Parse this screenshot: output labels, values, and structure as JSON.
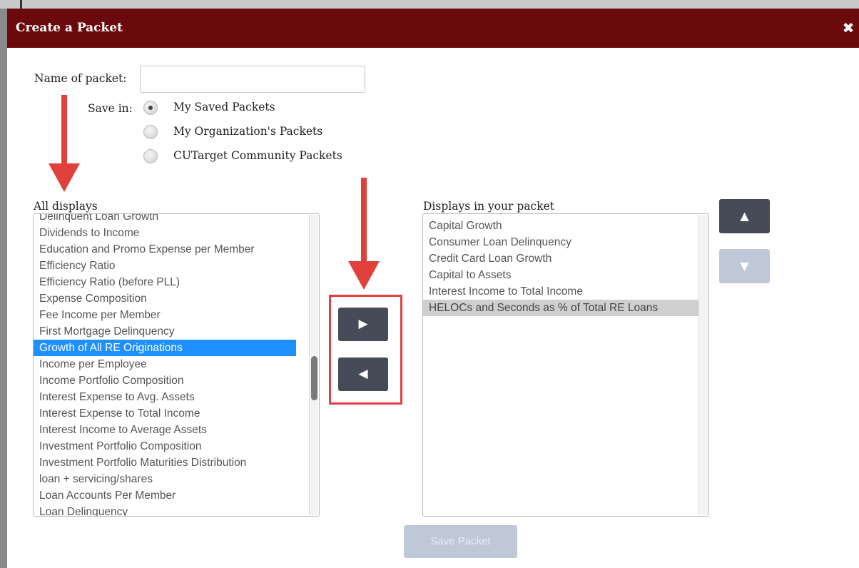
{
  "dialog": {
    "title": "Create a Packet",
    "close_icon": "close-icon",
    "colors": {
      "titlebar": "#6b0a0d",
      "selected": "#1e90ff",
      "dark_button": "#454b57",
      "annotation_red": "#e0413c"
    }
  },
  "form": {
    "name_label": "Name of packet:",
    "name_value": "",
    "save_in_label": "Save in:",
    "options": [
      {
        "label": "My Saved Packets",
        "selected": true
      },
      {
        "label": "My Organization's Packets",
        "selected": false
      },
      {
        "label": "CUTarget Community Packets",
        "selected": false
      }
    ]
  },
  "all_displays": {
    "label": "All displays",
    "items": [
      "Delinquent Loan Growth",
      "Dividends to Income",
      "Education and Promo Expense per Member",
      "Efficiency Ratio",
      "Efficiency Ratio (before PLL)",
      "Expense Composition",
      "Fee Income per Member",
      "First Mortgage Delinquency",
      "Growth of All RE Originations",
      "Income per Employee",
      "Income Portfolio Composition",
      "Interest Expense to Avg. Assets",
      "Interest Expense to Total Income",
      "Interest Income to Average Assets",
      "Investment Portfolio Composition",
      "Investment Portfolio Maturities Distribution",
      "loan + servicing/shares",
      "Loan Accounts Per Member",
      "Loan Delinquency"
    ],
    "selected_item": "Growth of All RE Originations"
  },
  "packet_displays": {
    "label": "Displays in your packet",
    "items": [
      "Capital Growth",
      "Consumer Loan Delinquency",
      "Credit Card Loan Growth",
      "Capital to Assets",
      "Interest Income to Total Income",
      "HELOCs and Seconds as % of Total RE Loans"
    ],
    "highlighted_item": "HELOCs and Seconds as % of Total RE Loans"
  },
  "buttons": {
    "add_glyph": "▶",
    "remove_glyph": "◀",
    "move_up_glyph": "▲",
    "move_down_glyph": "▼",
    "save_packet": "Save Packet"
  }
}
